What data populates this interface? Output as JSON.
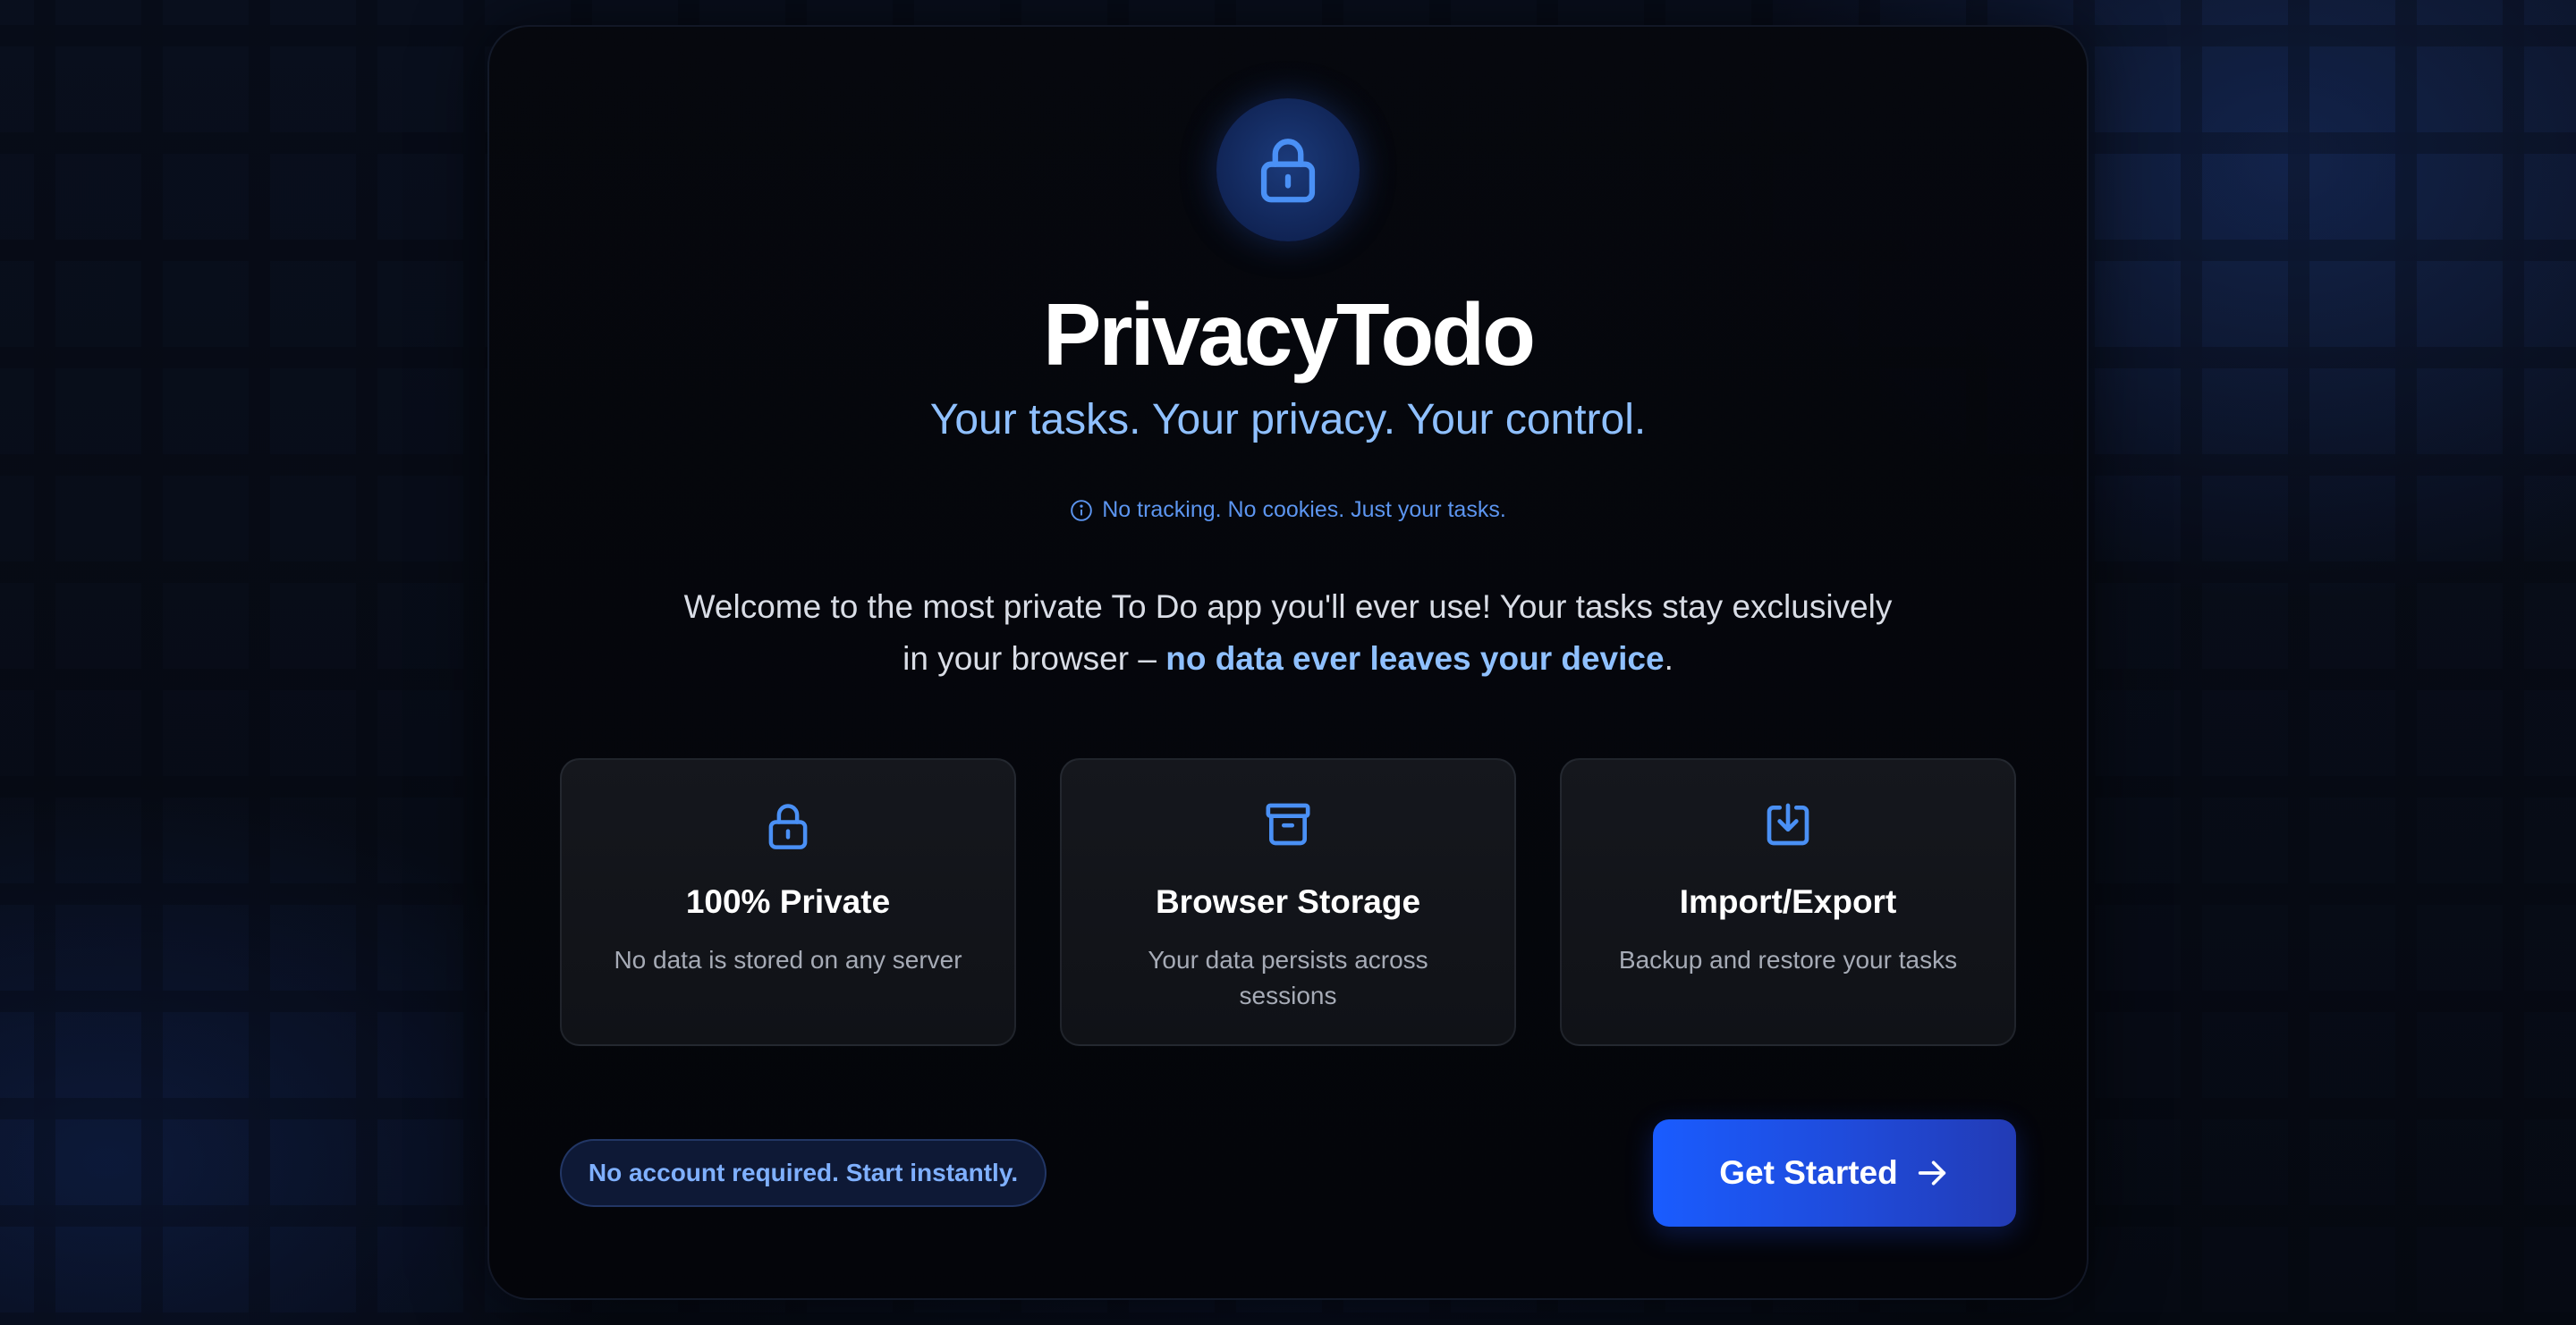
{
  "app": {
    "title": "PrivacyTodo",
    "tagline": "Your tasks. Your privacy. Your control.",
    "notice": "No tracking. No cookies. Just your tasks."
  },
  "intro": {
    "text_before": "Welcome to the most private To Do app you'll ever use! Your tasks stay exclusively in your browser – ",
    "highlight": "no data ever leaves your device",
    "text_after": "."
  },
  "features": [
    {
      "icon": "lock-icon",
      "title": "100% Private",
      "description": "No data is stored on any server"
    },
    {
      "icon": "archive-icon",
      "title": "Browser Storage",
      "description": "Your data persists across sessions"
    },
    {
      "icon": "download-icon",
      "title": "Import/Export",
      "description": "Backup and restore your tasks"
    }
  ],
  "badge": "No account required. Start instantly.",
  "cta": {
    "label": "Get Started",
    "icon": "arrow-right-icon"
  },
  "colors": {
    "accent": "#4a90f5",
    "highlight_text": "#8fc0ff",
    "button_start": "#1a5cff",
    "button_end": "#223bb5",
    "background": "#05070d"
  }
}
